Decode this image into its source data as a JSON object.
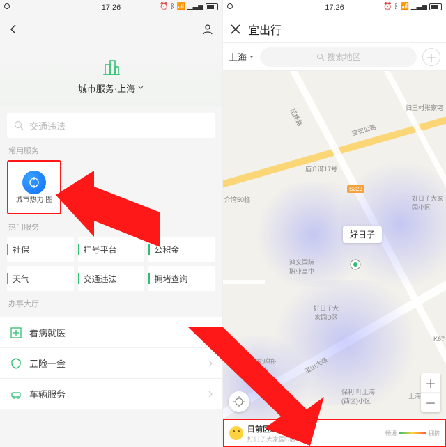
{
  "status": {
    "time": "17:26",
    "battery": "63"
  },
  "left": {
    "hero_title": "城市服务·上海",
    "search_placeholder": "交通违法",
    "section_common": "常用服务",
    "heatmap_label": "城市热力\n图",
    "section_hot": "热门服务",
    "hot_items": [
      "社保",
      "挂号平台",
      "公积金",
      "天气",
      "交通违法",
      "拥堵查询"
    ],
    "section_hall": "办事大厅",
    "hall_items": [
      "看病就医",
      "五险一金",
      "车辆服务"
    ]
  },
  "right": {
    "title": "宜出行",
    "city": "上海",
    "search_placeholder": "搜索地区",
    "callout": "好日子",
    "pois": {
      "p1": "归王村张家宅",
      "p2": "宝安公路",
      "p3": "庙介湾17号",
      "p4": "介湾50临",
      "p5": "好日子大家\n园小区",
      "p6": "鸿义国际\n职业高中",
      "p7": "好日子大\n家园D区",
      "p8": "如家派柏·\n云酒店",
      "p9": "宝山大路",
      "p10": "保利·叶上海\n(西区)小区",
      "p11": "上海小区",
      "p12": "延杨路",
      "p13": "K67"
    },
    "orange": "S322",
    "bottom_title": "目前区域人数",
    "bottom_badge": "畅通",
    "bottom_sub": "好日子大家园D区",
    "legend_a": "畅通",
    "legend_b": "拥挤"
  }
}
